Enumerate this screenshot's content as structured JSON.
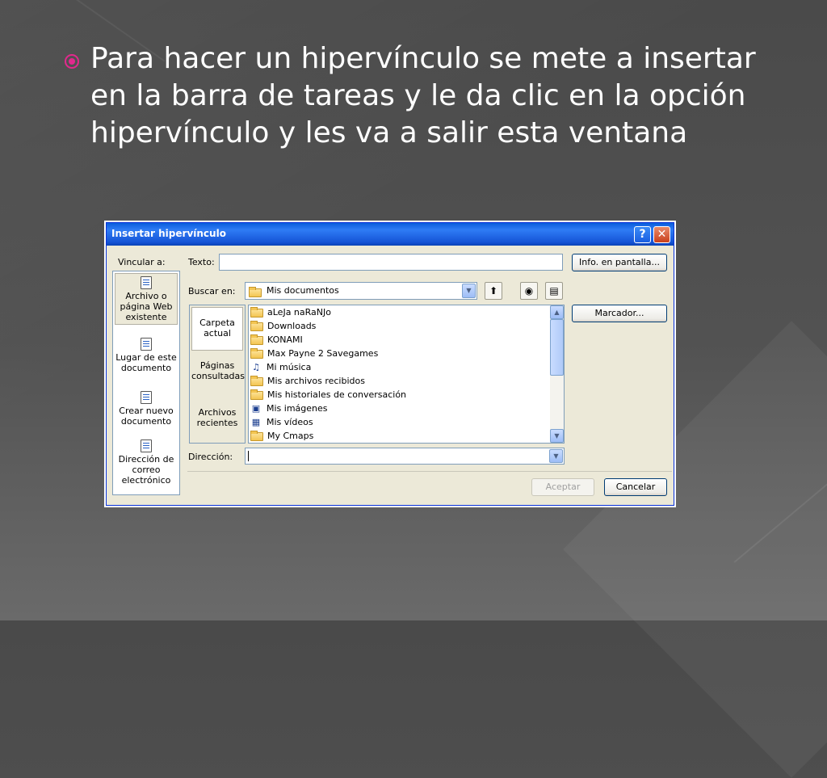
{
  "slide": {
    "bullet_text": "Para hacer un hipervínculo se mete a insertar en la barra de tareas y le da clic en la opción hipervínculo y les va a salir esta ventana"
  },
  "dialog": {
    "title": "Insertar hipervínculo",
    "help_glyph": "?",
    "close_glyph": "✕",
    "link_to_label": "Vincular a:",
    "text_label": "Texto:",
    "text_value": "",
    "screen_tip_button": "Info. en pantalla...",
    "look_in_label": "Buscar en:",
    "look_in_value": "Mis documentos",
    "bookmark_button": "Marcador...",
    "address_label": "Dirección:",
    "address_value": "",
    "ok_button": "Aceptar",
    "cancel_button": "Cancelar",
    "link_targets": [
      "Archivo o página Web existente",
      "Lugar de este documento",
      "Crear nuevo documento",
      "Dirección de correo electrónico"
    ],
    "browse_tabs": [
      "Carpeta actual",
      "Páginas consultadas",
      "Archivos recientes"
    ],
    "files": [
      {
        "name": "aLeJa naRaNJo",
        "icon": "folder-icon"
      },
      {
        "name": "Downloads",
        "icon": "folder-icon"
      },
      {
        "name": "KONAMI",
        "icon": "folder-icon"
      },
      {
        "name": "Max Payne 2 Savegames",
        "icon": "folder-icon"
      },
      {
        "name": "Mi música",
        "icon": "music-folder-icon"
      },
      {
        "name": "Mis archivos recibidos",
        "icon": "folder-icon"
      },
      {
        "name": "Mis historiales de conversación",
        "icon": "folder-icon"
      },
      {
        "name": "Mis imágenes",
        "icon": "pictures-folder-icon"
      },
      {
        "name": "Mis vídeos",
        "icon": "videos-folder-icon"
      },
      {
        "name": "My Cmaps",
        "icon": "folder-icon"
      }
    ]
  }
}
